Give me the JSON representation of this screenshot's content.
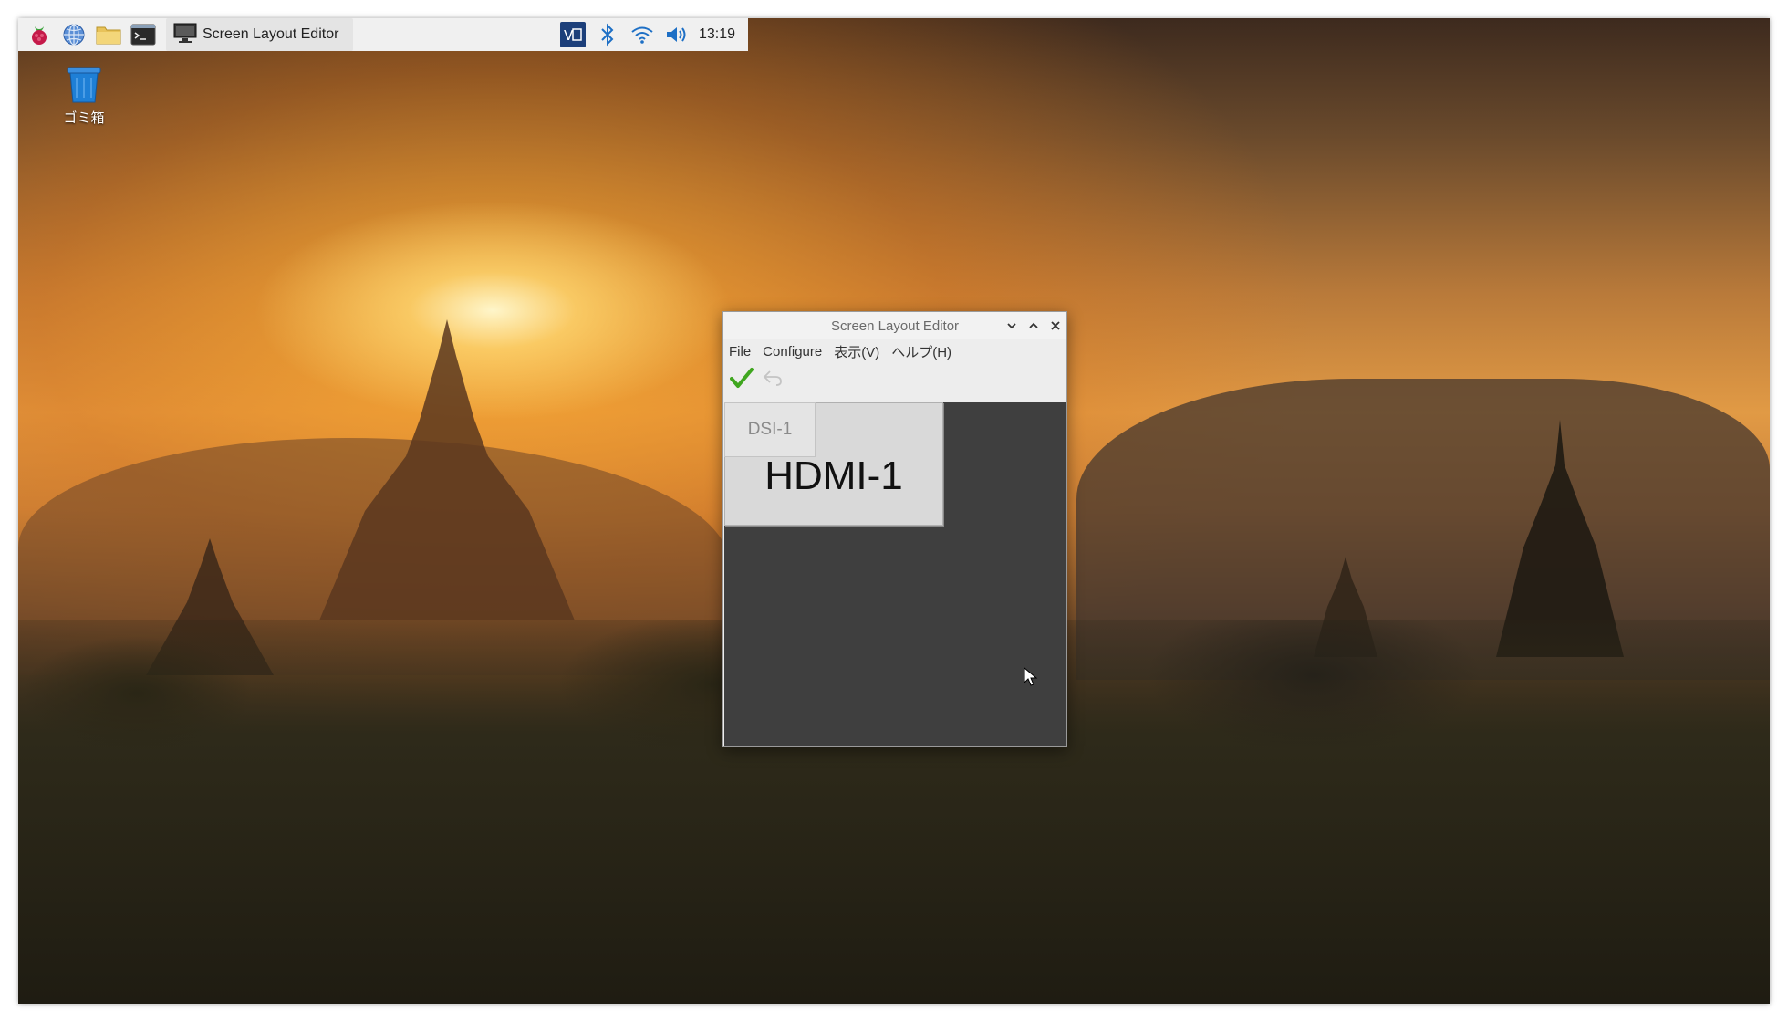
{
  "taskbar": {
    "task_label": "Screen Layout Editor",
    "clock": "13:19",
    "launchers": [
      "raspberry-menu-icon",
      "globe-icon",
      "folder-icon",
      "terminal-icon"
    ],
    "tray": [
      "vnc-icon",
      "bluetooth-icon",
      "wifi-icon",
      "volume-icon"
    ]
  },
  "desktop": {
    "trash_label": "ゴミ箱"
  },
  "window": {
    "title": "Screen Layout Editor",
    "controls": [
      "minimize",
      "maximize",
      "close"
    ],
    "menu": [
      "File",
      "Configure",
      "表示(V)",
      "ヘルプ(H)"
    ],
    "toolbar": {
      "apply_icon": "checkmark-icon",
      "undo_icon": "undo-icon",
      "undo_enabled": false
    },
    "monitors": [
      {
        "name": "HDMI-1",
        "active": true
      },
      {
        "name": "DSI-1",
        "active": false
      }
    ]
  },
  "colors": {
    "taskbar_bg": "#f0f0f0",
    "canvas_bg": "#3f3f3f",
    "monitor_bg": "#d9d9d9",
    "checkmark": "#3fa61f",
    "trash_blue": "#1e7fd6"
  }
}
